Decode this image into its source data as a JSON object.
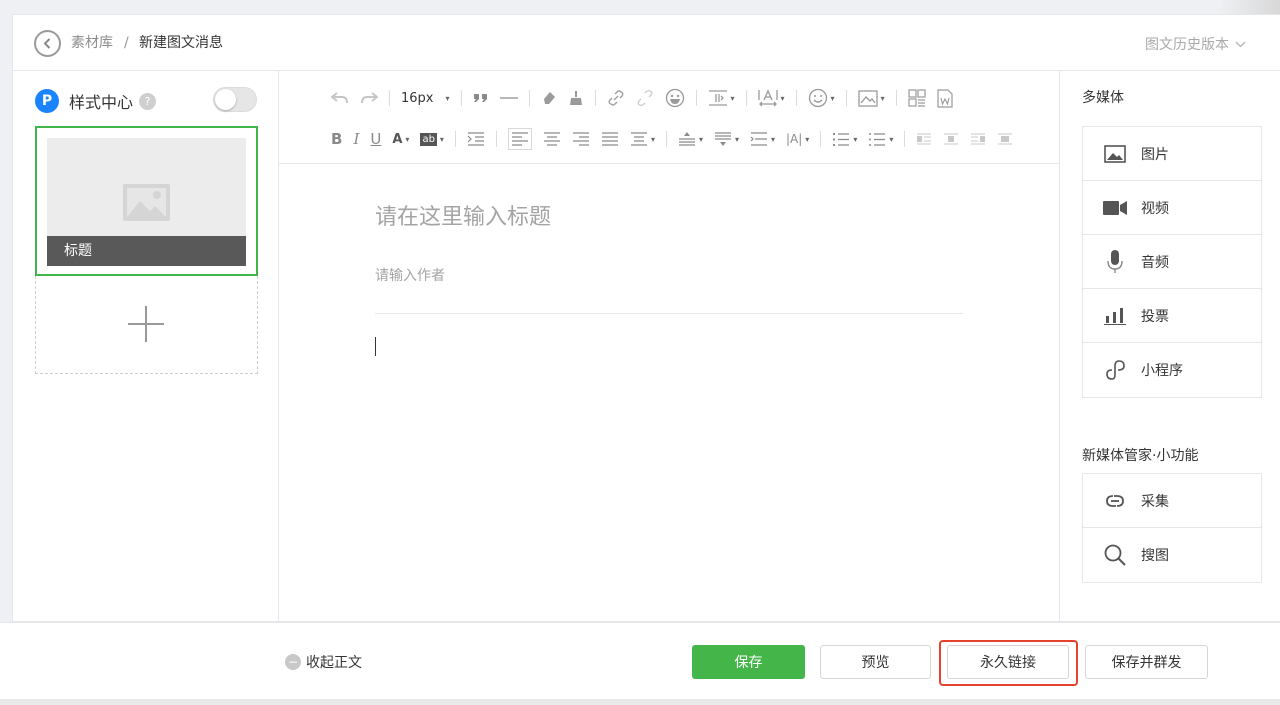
{
  "header": {
    "breadcrumb_library": "素材库",
    "breadcrumb_separator": "/",
    "breadcrumb_current": "新建图文消息",
    "history_label": "图文历史版本"
  },
  "sidebar": {
    "style_center_badge": "P",
    "style_center_label": "样式中心",
    "help_glyph": "?",
    "style_center_enabled": false,
    "article_title": "标题"
  },
  "toolbar": {
    "font_size": "16px",
    "caret": "▾",
    "bold": "B",
    "italic": "I",
    "underline": "U",
    "font_color": "A",
    "bg_color": "ab",
    "letter_spacing": "|A|"
  },
  "editor": {
    "title_placeholder": "请在这里输入标题",
    "author_placeholder": "请输入作者"
  },
  "media": {
    "heading": "多媒体",
    "items": [
      {
        "label": "图片",
        "icon": "image-icon"
      },
      {
        "label": "视频",
        "icon": "video-icon"
      },
      {
        "label": "音频",
        "icon": "microphone-icon"
      },
      {
        "label": "投票",
        "icon": "vote-icon"
      },
      {
        "label": "小程序",
        "icon": "mini-program-icon"
      }
    ]
  },
  "tools": {
    "heading": "新媒体管家·小功能",
    "items": [
      {
        "label": "采集",
        "icon": "collect-icon"
      },
      {
        "label": "搜图",
        "icon": "search-icon"
      }
    ]
  },
  "footer": {
    "collapse_icon": "−",
    "collapse_label": "收起正文",
    "save": "保存",
    "preview": "预览",
    "permalink": "永久链接",
    "save_and_send": "保存并群发"
  },
  "colors": {
    "primary_green": "#44b549",
    "selected_border": "#41b44a",
    "highlight_red": "#e7422f",
    "style_center_blue": "#1a84ff"
  }
}
